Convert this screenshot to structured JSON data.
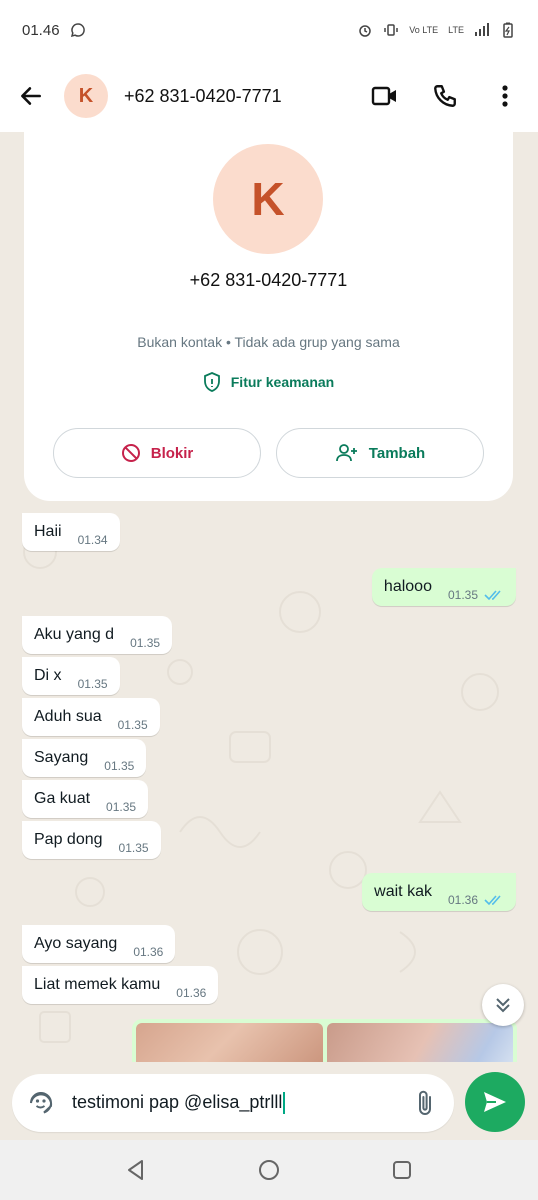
{
  "status_bar": {
    "time": "01.46",
    "network": "Vo LTE",
    "net_type": "LTE"
  },
  "header": {
    "avatar_letter": "K",
    "contact_name": "+62 831-0420-7771"
  },
  "profile_card": {
    "avatar_letter": "K",
    "phone": "+62 831-0420-7771",
    "subtitle": "Bukan kontak • Tidak ada grup yang sama",
    "security_label": "Fitur keamanan",
    "block_label": "Blokir",
    "add_label": "Tambah"
  },
  "messages": [
    {
      "dir": "in",
      "text": "Haii",
      "time": "01.34"
    },
    {
      "dir": "out",
      "text": "halooo",
      "time": "01.35"
    },
    {
      "dir": "in",
      "text": "Aku yang d",
      "time": "01.35"
    },
    {
      "dir": "in",
      "text": "Di x",
      "time": "01.35"
    },
    {
      "dir": "in",
      "text": "Aduh sua",
      "time": "01.35"
    },
    {
      "dir": "in",
      "text": "Sayang",
      "time": "01.35"
    },
    {
      "dir": "in",
      "text": "Ga kuat",
      "time": "01.35"
    },
    {
      "dir": "in",
      "text": "Pap dong",
      "time": "01.35"
    },
    {
      "dir": "out",
      "text": "wait kak",
      "time": "01.36"
    },
    {
      "dir": "in",
      "text": "Ayo sayang",
      "time": "01.36"
    },
    {
      "dir": "in",
      "text": "Liat memek kamu",
      "time": "01.36"
    }
  ],
  "composer": {
    "text": "testimoni pap @elisa_ptrlll"
  },
  "colors": {
    "accent": "#1daa61",
    "chat_bg": "#efeae2",
    "outgoing": "#d9fdd3",
    "ticks": "#53bdeb",
    "danger": "#c6224b"
  },
  "icons": [
    "back-arrow-icon",
    "video-call-icon",
    "phone-icon",
    "more-icon",
    "shield-icon",
    "block-icon",
    "add-contact-icon",
    "double-check-icon",
    "chevron-double-down-icon",
    "sticker-icon",
    "attach-icon",
    "send-icon",
    "nav-back-icon",
    "nav-home-icon",
    "nav-recents-icon"
  ]
}
